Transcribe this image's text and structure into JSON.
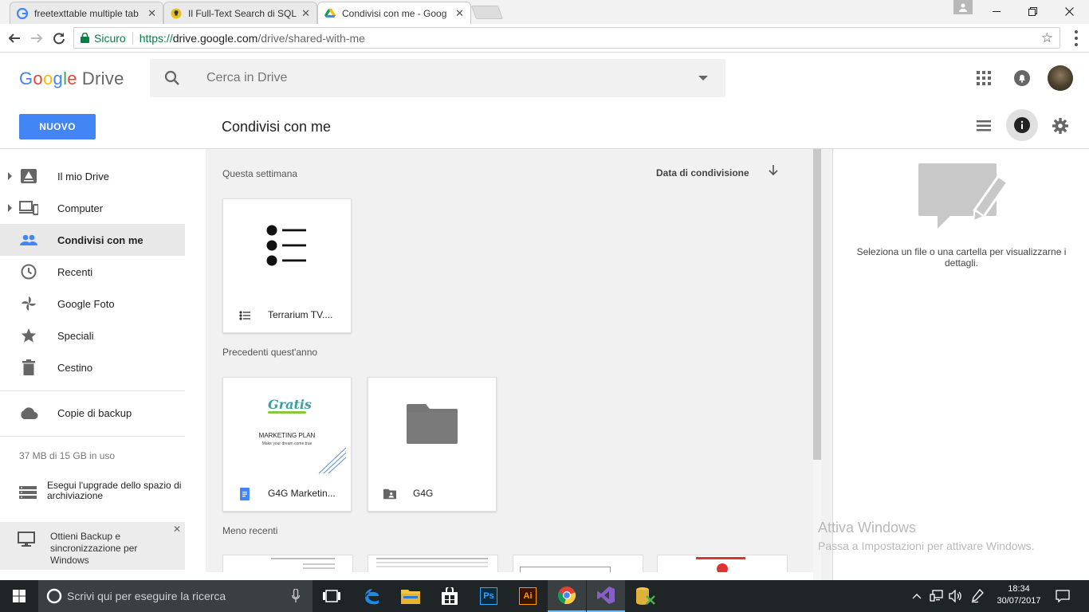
{
  "browser": {
    "tabs": [
      {
        "title": "freetexttable multiple tab",
        "favicon": "google-icon"
      },
      {
        "title": "Il Full-Text Search di SQL",
        "favicon": "bulb-icon"
      },
      {
        "title": "Condivisi con me - Goog",
        "favicon": "drive-icon",
        "active": true
      }
    ],
    "secure_label": "Sicuro",
    "url_scheme": "https://",
    "url_host": "drive.google.com",
    "url_path": "/drive/shared-with-me"
  },
  "header": {
    "logo_google": "Google",
    "logo_drive": "Drive",
    "search_placeholder": "Cerca in Drive",
    "new_button": "NUOVO",
    "page_title": "Condivisi con me"
  },
  "sidebar": {
    "items": [
      {
        "label": "Il mio Drive",
        "icon": "my-drive-icon",
        "expandable": true
      },
      {
        "label": "Computer",
        "icon": "computer-icon",
        "expandable": true
      },
      {
        "label": "Condivisi con me",
        "icon": "shared-people-icon",
        "selected": true
      },
      {
        "label": "Recenti",
        "icon": "clock-icon"
      },
      {
        "label": "Google Foto",
        "icon": "pinwheel-icon"
      },
      {
        "label": "Speciali",
        "icon": "star-icon"
      },
      {
        "label": "Cestino",
        "icon": "trash-icon"
      }
    ],
    "backup": "Copie di backup",
    "quota": "37 MB di 15 GB in uso",
    "upgrade": "Esegui l'upgrade dello spazio di archiviazione",
    "promo": "Ottieni Backup e sincronizzazione per Windows"
  },
  "main": {
    "sort_label": "Data di condivisione",
    "sections": [
      {
        "label": "Questa settimana",
        "files": [
          {
            "name": "Terrarium TV....",
            "type": "list-document"
          }
        ]
      },
      {
        "label": "Precedenti quest'anno",
        "files": [
          {
            "name": "G4G Marketin...",
            "type": "google-doc"
          },
          {
            "name": "G4G",
            "type": "shared-folder"
          }
        ]
      },
      {
        "label": "Meno recenti",
        "files": []
      }
    ],
    "doc_preview": {
      "brand": "Gratis",
      "subtitle": "MARKETING PLAN",
      "tagline": "Make your dream come true"
    }
  },
  "details": {
    "empty_message": "Seleziona un file o una cartella per visualizzarne i dettagli."
  },
  "watermark": {
    "title": "Attiva Windows",
    "subtitle": "Passa a Impostazioni per attivare Windows."
  },
  "taskbar": {
    "search_placeholder": "Scrivi qui per eseguire la ricerca",
    "time": "18:34",
    "date": "30/07/2017",
    "apps": [
      "task-view-icon",
      "edge-icon",
      "explorer-icon",
      "store-icon",
      "photoshop-icon",
      "illustrator-icon",
      "chrome-icon",
      "visual-studio-icon",
      "sql-server-icon"
    ]
  },
  "colors": {
    "accent_blue": "#4285f4",
    "secure_green": "#0b8043",
    "taskbar": "#1f2426"
  }
}
